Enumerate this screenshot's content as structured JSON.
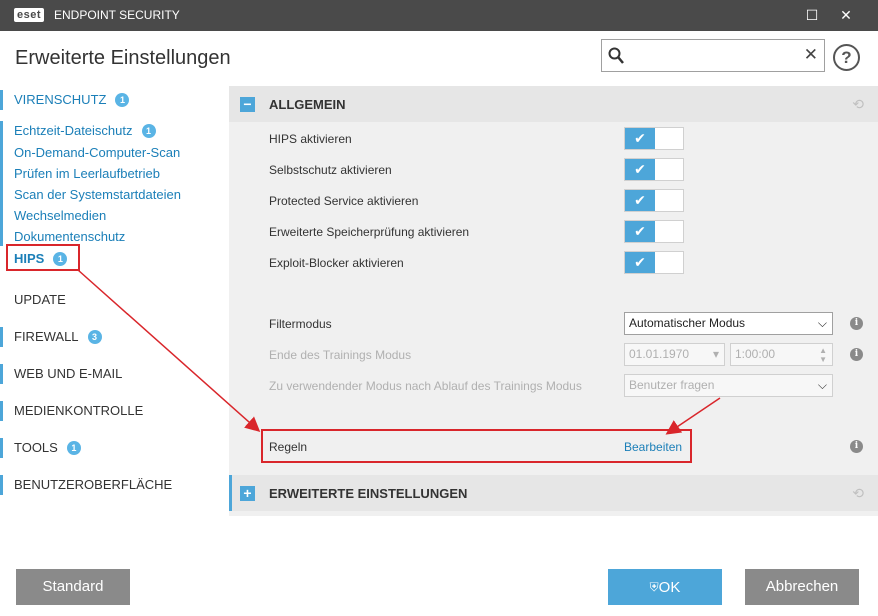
{
  "titlebar": {
    "logo": "eset",
    "app_title": "ENDPOINT SECURITY",
    "minimize_icon": "☐",
    "close_icon": "✕"
  },
  "header": {
    "page_title": "Erweiterte Einstellungen",
    "search_value": "",
    "help_label": "?"
  },
  "sidebar": {
    "virenschutz": {
      "label": "VIRENSCHUTZ",
      "badge": "1"
    },
    "subitems": [
      {
        "label": "Echtzeit-Dateischutz",
        "badge": "1"
      },
      {
        "label": "On-Demand-Computer-Scan"
      },
      {
        "label": "Prüfen im Leerlaufbetrieb"
      },
      {
        "label": "Scan der Systemstartdateien"
      },
      {
        "label": "Wechselmedien"
      },
      {
        "label": "Dokumentenschutz"
      }
    ],
    "hips": {
      "label": "HIPS",
      "badge": "1"
    },
    "sections": [
      {
        "label": "UPDATE"
      },
      {
        "label": "FIREWALL",
        "badge": "3"
      },
      {
        "label": "WEB UND E-MAIL"
      },
      {
        "label": "MEDIENKONTROLLE"
      },
      {
        "label": "TOOLS",
        "badge": "1"
      },
      {
        "label": "BENUTZEROBERFLÄCHE"
      }
    ]
  },
  "content": {
    "allgemein": {
      "label": "ALLGEMEIN",
      "toggle": "−"
    },
    "toggles": [
      {
        "label": "HIPS aktivieren",
        "enabled": true
      },
      {
        "label": "Selbstschutz aktivieren",
        "enabled": true
      },
      {
        "label": "Protected Service aktivieren",
        "enabled": true
      },
      {
        "label": "Erweiterte Speicherprüfung aktivieren",
        "enabled": true
      },
      {
        "label": "Exploit-Blocker aktivieren",
        "enabled": true
      }
    ],
    "filtermodus": {
      "label": "Filtermodus",
      "value": "Automatischer Modus"
    },
    "training_end": {
      "label": "Ende des Trainings Modus",
      "date": "01.01.1970",
      "time": "1:00:00"
    },
    "after_training": {
      "label": "Zu verwendender Modus nach Ablauf des Trainings Modus",
      "value": "Benutzer fragen"
    },
    "regeln": {
      "label": "Regeln",
      "link": "Bearbeiten"
    },
    "erweiterte": {
      "label": "ERWEITERTE EINSTELLUNGEN",
      "toggle": "+"
    }
  },
  "footer": {
    "standard": "Standard",
    "ok": "OK",
    "cancel": "Abbrechen"
  },
  "colors": {
    "accent": "#4da6d9",
    "highlight": "#d9262b",
    "titlebar": "#4a4a4a"
  }
}
